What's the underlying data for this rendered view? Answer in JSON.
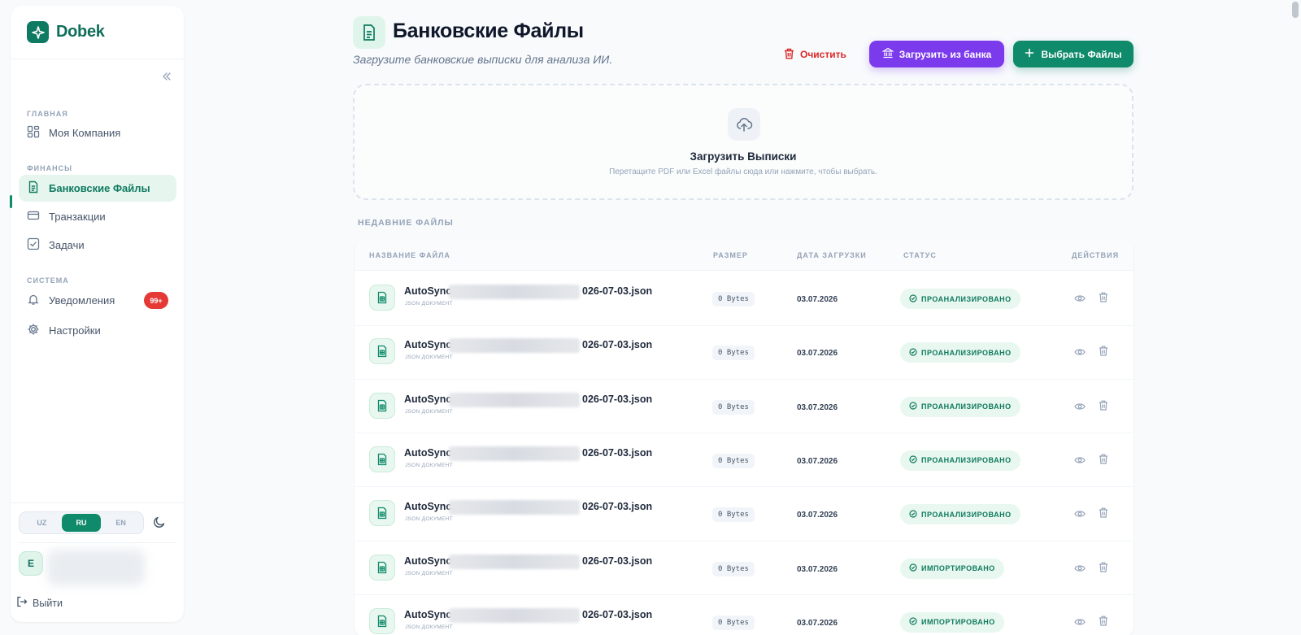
{
  "brand": {
    "name": "Dobek"
  },
  "sidebar": {
    "sections": [
      {
        "label": "ГЛАВНАЯ"
      },
      {
        "label": "ФИНАНСЫ"
      },
      {
        "label": "СИСТЕМА"
      }
    ],
    "items": [
      {
        "label": "Моя Компания",
        "icon": "dashboard-icon"
      },
      {
        "label": "Банковские Файлы",
        "icon": "document-icon",
        "active": true
      },
      {
        "label": "Транзакции",
        "icon": "credit-card-icon"
      },
      {
        "label": "Задачи",
        "icon": "checkbox-icon"
      },
      {
        "label": "Уведомления",
        "icon": "bell-icon",
        "badge": "99+"
      },
      {
        "label": "Настройки",
        "icon": "gear-icon"
      }
    ],
    "languages": [
      "UZ",
      "RU",
      "EN"
    ],
    "selected_language": "RU",
    "user_initial": "E",
    "logout_label": "Выйти"
  },
  "header": {
    "title": "Банковские Файлы",
    "subtitle": "Загрузите банковские выписки для анализа ИИ.",
    "clear_label": "Очистить",
    "bank_label": "Загрузить из банка",
    "pick_label": "Выбрать Файлы"
  },
  "dropzone": {
    "title": "Загрузить Выписки",
    "subtitle": "Перетащите PDF или Excel файлы сюда или нажмите, чтобы выбрать."
  },
  "recent": {
    "label": "НЕДАВНИЕ ФАЙЛЫ",
    "columns": [
      "НАЗВАНИЕ ФАЙЛА",
      "РАЗМЕР",
      "ДАТА ЗАГРУЗКИ",
      "СТАТУС",
      "ДЕЙСТВИЯ"
    ],
    "rows": [
      {
        "name_prefix": "AutoSync",
        "name_suffix": "026-07-03.json",
        "type": "JSON ДОКУМЕНТ",
        "size": "0 Bytes",
        "date": "03.07.2026",
        "status": "ПРОАНАЛИЗИРОВАНО"
      },
      {
        "name_prefix": "AutoSync",
        "name_suffix": "026-07-03.json",
        "type": "JSON ДОКУМЕНТ",
        "size": "0 Bytes",
        "date": "03.07.2026",
        "status": "ПРОАНАЛИЗИРОВАНО"
      },
      {
        "name_prefix": "AutoSync",
        "name_suffix": "026-07-03.json",
        "type": "JSON ДОКУМЕНТ",
        "size": "0 Bytes",
        "date": "03.07.2026",
        "status": "ПРОАНАЛИЗИРОВАНО"
      },
      {
        "name_prefix": "AutoSync",
        "name_suffix": "026-07-03.json",
        "type": "JSON ДОКУМЕНТ",
        "size": "0 Bytes",
        "date": "03.07.2026",
        "status": "ПРОАНАЛИЗИРОВАНО"
      },
      {
        "name_prefix": "AutoSync",
        "name_suffix": "026-07-03.json",
        "type": "JSON ДОКУМЕНТ",
        "size": "0 Bytes",
        "date": "03.07.2026",
        "status": "ПРОАНАЛИЗИРОВАНО"
      },
      {
        "name_prefix": "AutoSync",
        "name_suffix": "026-07-03.json",
        "type": "JSON ДОКУМЕНТ",
        "size": "0 Bytes",
        "date": "03.07.2026",
        "status": "ИМПОРТИРОВАНО"
      },
      {
        "name_prefix": "AutoSync",
        "name_suffix": "026-07-03.json",
        "type": "JSON ДОКУМЕНТ",
        "size": "0 Bytes",
        "date": "03.07.2026",
        "status": "ИМПОРТИРОВАНО"
      }
    ]
  },
  "colors": {
    "brand": "#0f8a6a",
    "bank_button": "#7c3aed",
    "danger": "#dc2626",
    "badge": "#e53935"
  }
}
